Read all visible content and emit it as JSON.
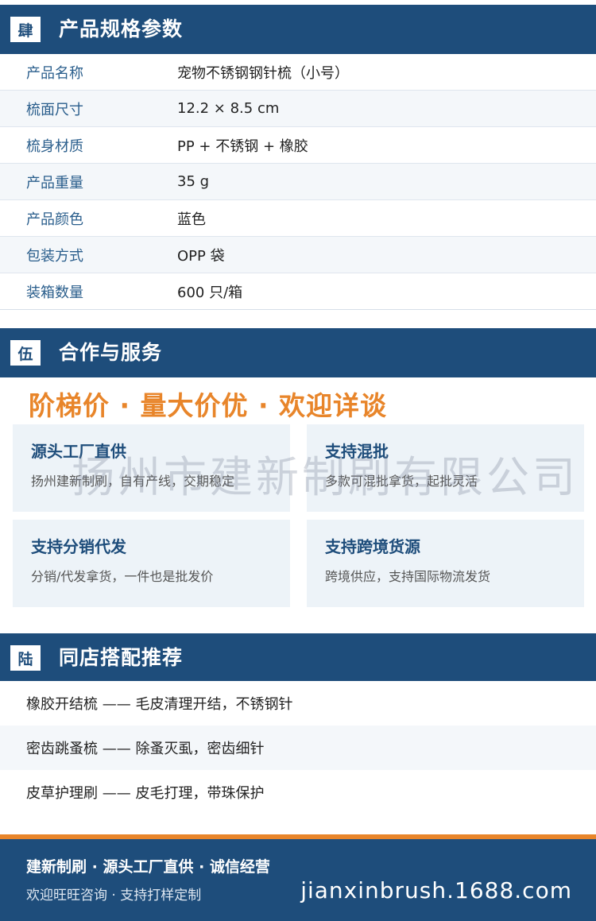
{
  "spec_section": {
    "badge": "肆",
    "title": "产品规格参数",
    "rows": [
      {
        "key": "产品名称",
        "value": "宠物不锈钢钢针梳（小号）"
      },
      {
        "key": "梳面尺寸",
        "value": "12.2 × 8.5 cm"
      },
      {
        "key": "梳身材质",
        "value": "PP + 不锈钢 + 橡胶"
      },
      {
        "key": "产品重量",
        "value": "35 g"
      },
      {
        "key": "产品颜色",
        "value": "蓝色"
      },
      {
        "key": "包装方式",
        "value": "OPP 袋"
      },
      {
        "key": "装箱数量",
        "value": "600 只/箱"
      }
    ]
  },
  "service_section": {
    "badge": "伍",
    "title": "合作与服务",
    "slogan": "阶梯价 · 量大价优 · 欢迎详谈",
    "watermark": "扬州市建新制刷有限公司",
    "cards": [
      {
        "title": "源头工厂直供",
        "desc": "扬州建新制刷，自有产线，交期稳定"
      },
      {
        "title": "支持混批",
        "desc": "多款可混批拿货，起批灵活"
      },
      {
        "title": "支持分销代发",
        "desc": "分销/代发拿货，一件也是批发价"
      },
      {
        "title": "支持跨境货源",
        "desc": "跨境供应，支持国际物流发货"
      }
    ]
  },
  "recommend_section": {
    "badge": "陆",
    "title": "同店搭配推荐",
    "items": [
      "橡胶开结梳 —— 毛皮清理开结，不锈钢针",
      "密齿跳蚤梳 —— 除蚤灭虱，密齿细针",
      "皮草护理刷 —— 皮毛打理，带珠保护"
    ]
  },
  "footer": {
    "line1": "建新制刷 · 源头工厂直供 · 诚信经营",
    "line2": "欢迎旺旺咨询 · 支持打样定制",
    "site": "jianxinbrush.1688.com"
  },
  "colors": {
    "header_blue": "#1e4d7b",
    "accent_orange": "#e8852a",
    "card_bg": "#edf3f8"
  }
}
